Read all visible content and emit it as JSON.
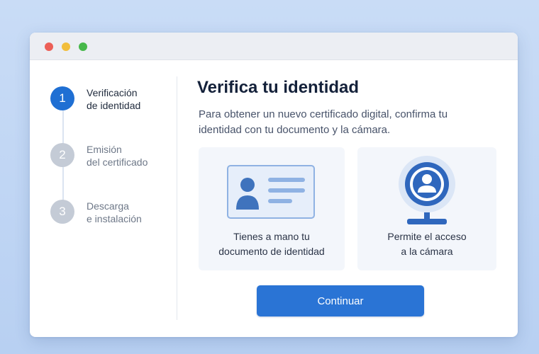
{
  "steps": [
    {
      "number": "1",
      "label": "Verificación\nde identidad",
      "state": "active"
    },
    {
      "number": "2",
      "label": "Emisión\ndel certificado",
      "state": "pending"
    },
    {
      "number": "3",
      "label": "Descarga\ne instalación",
      "state": "pending"
    }
  ],
  "main": {
    "title": "Verifica tu identidad",
    "subtitle": "Para obtener un nuevo certificado digital, confirma tu identidad con tu documento y la cámara."
  },
  "cards": [
    {
      "text": "Tienes a mano tu\ndocumento de identidad",
      "icon": "id-card-icon"
    },
    {
      "text": "Permite el acceso\na la cámara",
      "icon": "webcam-icon"
    }
  ],
  "continue_label": "Continuar",
  "colors": {
    "accent": "#2a74d5",
    "step_active": "#1f6fd3",
    "step_inactive": "#c4cbd6"
  }
}
